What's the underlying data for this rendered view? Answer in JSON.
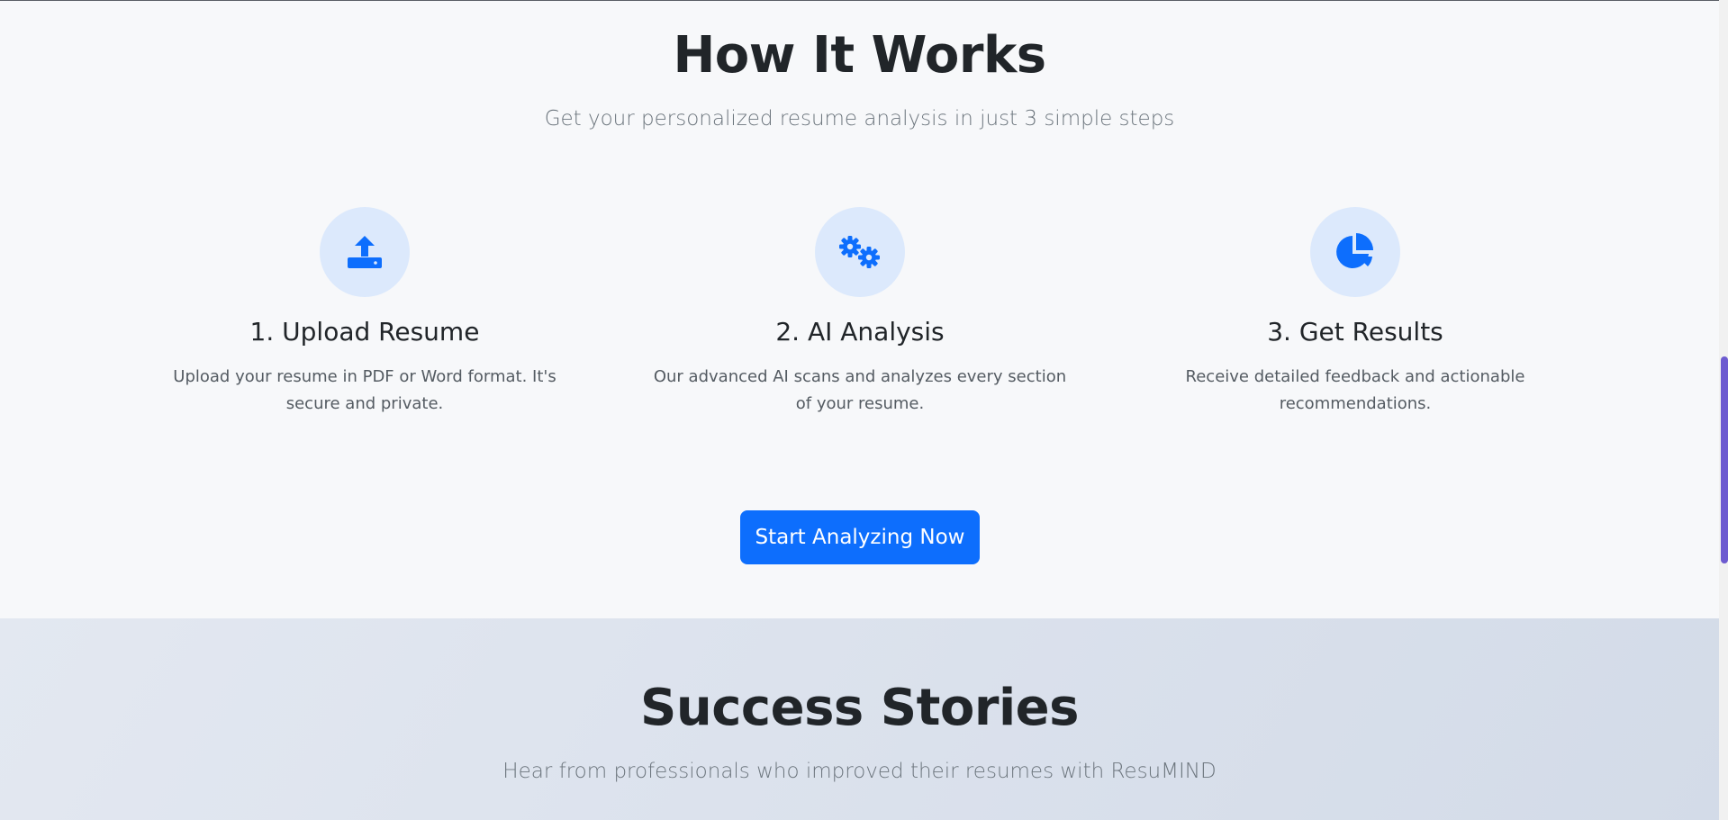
{
  "how_it_works": {
    "title": "How It Works",
    "subtitle": "Get your personalized resume analysis in just 3 simple steps",
    "steps": [
      {
        "icon": "upload-icon",
        "title": "1. Upload Resume",
        "description": "Upload your resume in PDF or Word format. It's secure and private."
      },
      {
        "icon": "gears-icon",
        "title": "2. AI Analysis",
        "description": "Our advanced AI scans and analyzes every section of your resume."
      },
      {
        "icon": "pie-chart-icon",
        "title": "3. Get Results",
        "description": "Receive detailed feedback and actionable recommendations."
      }
    ],
    "cta_label": "Start Analyzing Now"
  },
  "success_stories": {
    "title": "Success Stories",
    "subtitle": "Hear from professionals who improved their resumes with ResuMIND"
  },
  "colors": {
    "accent": "#0d6efd",
    "icon_circle": "#dce9fc",
    "scrollbar_thumb": "#6d5bd0"
  }
}
